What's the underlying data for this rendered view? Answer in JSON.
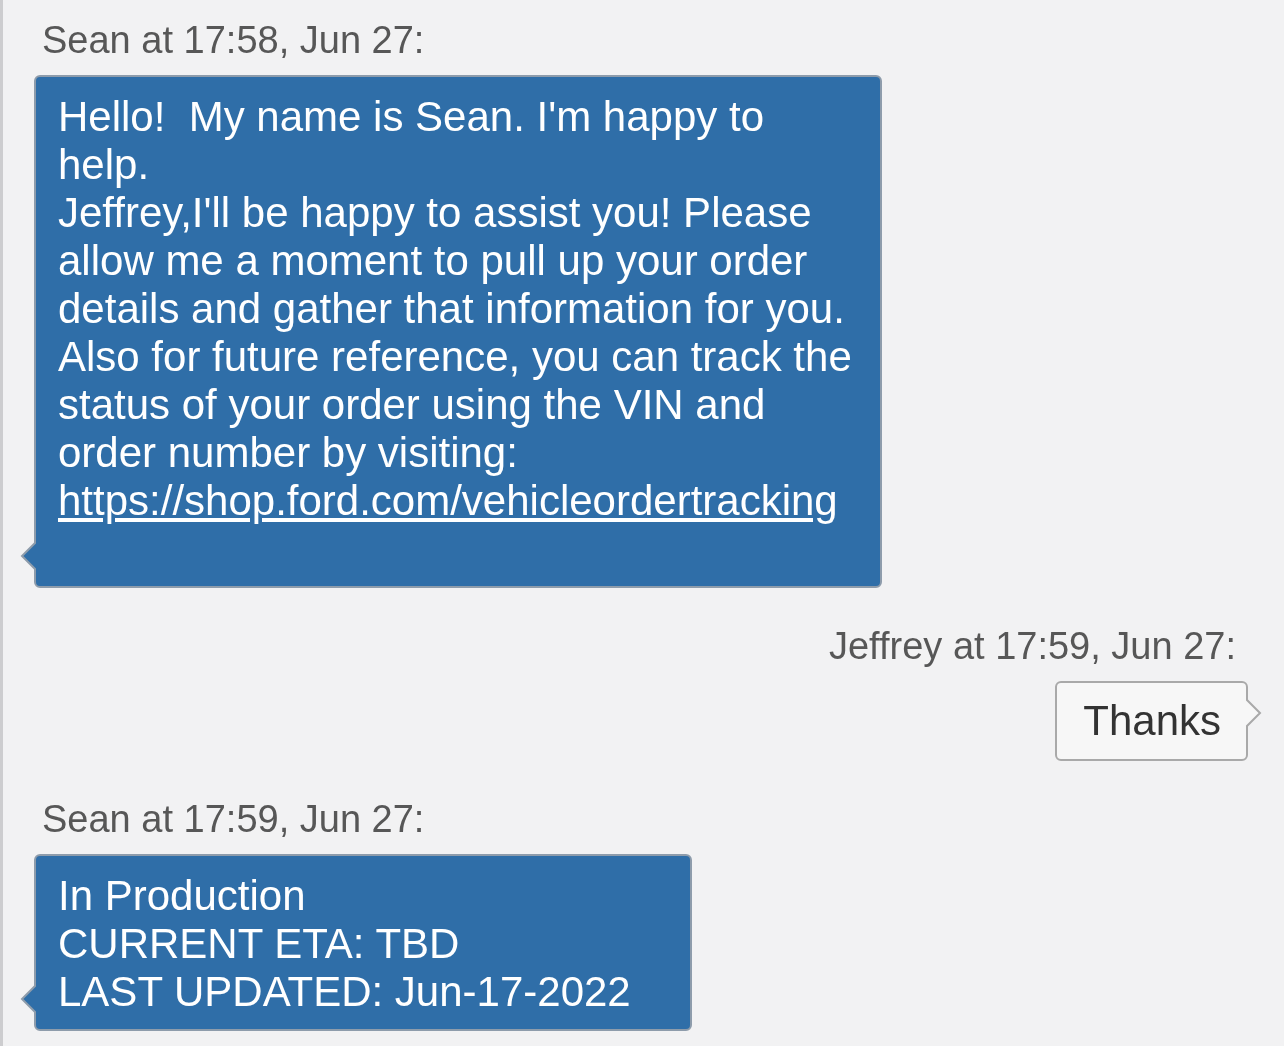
{
  "messages": [
    {
      "kind": "agent",
      "header": "Sean at 17:58, Jun 27:",
      "paragraphs": [
        "Hello!  My name is Sean. I'm happy to help.",
        "Jeffrey,I'll be happy to assist you! Please allow me a moment to pull up your order details and gather that information for you. Also for future reference, you can track the status of your order using the VIN and order number by visiting:"
      ],
      "link": "https://shop.ford.com/vehicleordertracking"
    },
    {
      "kind": "customer",
      "header": "Jeffrey at 17:59, Jun 27:",
      "paragraphs": [
        "Thanks"
      ]
    },
    {
      "kind": "agent",
      "header": "Sean at 17:59, Jun 27:",
      "paragraphs": [
        "In Production",
        "CURRENT ETA: TBD",
        "LAST UPDATED: Jun-17-2022"
      ]
    }
  ]
}
